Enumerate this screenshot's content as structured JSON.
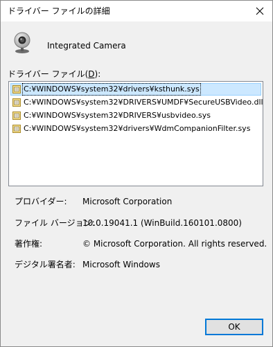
{
  "window": {
    "title": "ドライバー ファイルの詳細",
    "close_glyph": "✕"
  },
  "device": {
    "icon": "webcam-icon",
    "name": "Integrated Camera"
  },
  "files": {
    "label_prefix": "ドライバー ファイル(",
    "label_accesskey": "D",
    "label_suffix": "):",
    "items": [
      {
        "icon": "driver-file-icon",
        "path": "C:¥WINDOWS¥system32¥drivers¥ksthunk.sys",
        "selected": true
      },
      {
        "icon": "driver-file-icon",
        "path": "C:¥WINDOWS¥system32¥DRIVERS¥UMDF¥SecureUSBVideo.dll",
        "selected": false
      },
      {
        "icon": "driver-file-icon",
        "path": "C:¥WINDOWS¥system32¥DRIVERS¥usbvideo.sys",
        "selected": false
      },
      {
        "icon": "driver-file-icon",
        "path": "C:¥WINDOWS¥system32¥drivers¥WdmCompanionFilter.sys",
        "selected": false
      }
    ]
  },
  "properties": [
    {
      "label": "プロバイダー:",
      "value": "Microsoft Corporation"
    },
    {
      "label": "ファイル バージョン:",
      "value": "10.0.19041.1 (WinBuild.160101.0800)"
    },
    {
      "label": "著作権:",
      "value": "© Microsoft Corporation. All rights reserved."
    },
    {
      "label": "デジタル署名者:",
      "value": "Microsoft Windows"
    }
  ],
  "buttons": {
    "ok": "OK"
  },
  "colors": {
    "selection_bg": "#cce8ff",
    "selection_border": "#99d1ff",
    "default_button_border": "#0078d7",
    "dialog_bg": "#f0f0f0"
  }
}
